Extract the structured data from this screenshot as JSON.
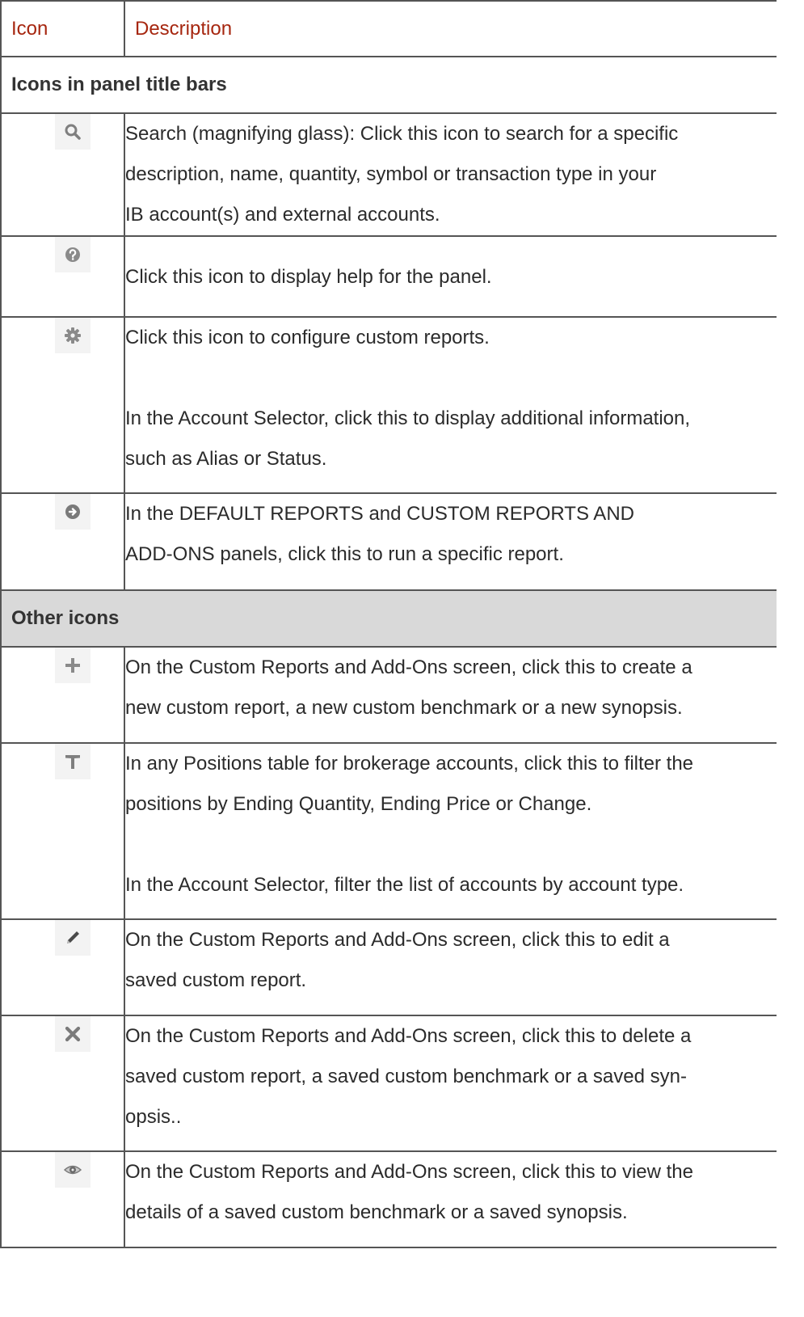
{
  "table": {
    "header": {
      "icon_col": "Icon",
      "desc_col": "Description"
    },
    "sections": [
      {
        "title": "Icons in panel title bars",
        "shaded": false,
        "rows": [
          {
            "icon": "search-icon",
            "lines": [
              "Search (magnifying glass): Click this icon to search for a specific",
              "description, name, quantity, symbol or transaction type in your",
              "IB account(s) and external accounts."
            ]
          },
          {
            "icon": "help-icon",
            "lines": [
              "Click this icon to display help for the panel."
            ]
          },
          {
            "icon": "gear-icon",
            "lines": [
              "Click this icon to configure custom reports.",
              "In the Account Selector, click this to display additional information,",
              "such as Alias or Status."
            ]
          },
          {
            "icon": "run-arrow-icon",
            "lines": [
              "In the DEFAULT REPORTS and CUSTOM REPORTS AND",
              "ADD-ONS panels, click this to run a specific report."
            ]
          }
        ]
      },
      {
        "title": "Other icons",
        "shaded": true,
        "rows": [
          {
            "icon": "plus-icon",
            "lines": [
              "On the Custom Reports and Add-Ons screen, click this to create a",
              "new custom report, a new custom benchmark or a new synopsis."
            ]
          },
          {
            "icon": "filter-icon",
            "lines": [
              "In any Positions table for brokerage accounts, click this to filter the",
              "positions by Ending Quantity, Ending Price or Change.",
              "In the Account Selector, filter the list of accounts by account type."
            ]
          },
          {
            "icon": "pencil-icon",
            "lines": [
              "On the Custom Reports and Add-Ons screen, click this to edit a",
              "saved custom report."
            ]
          },
          {
            "icon": "delete-x-icon",
            "lines": [
              "On the Custom Reports and Add-Ons screen, click this to delete a",
              "saved custom report, a saved custom benchmark or a saved syn-",
              "opsis.."
            ]
          },
          {
            "icon": "eye-icon",
            "lines": [
              "On the Custom Reports and Add-Ons screen, click this to view the",
              "details of a saved custom benchmark or a saved synopsis."
            ]
          }
        ]
      }
    ]
  }
}
